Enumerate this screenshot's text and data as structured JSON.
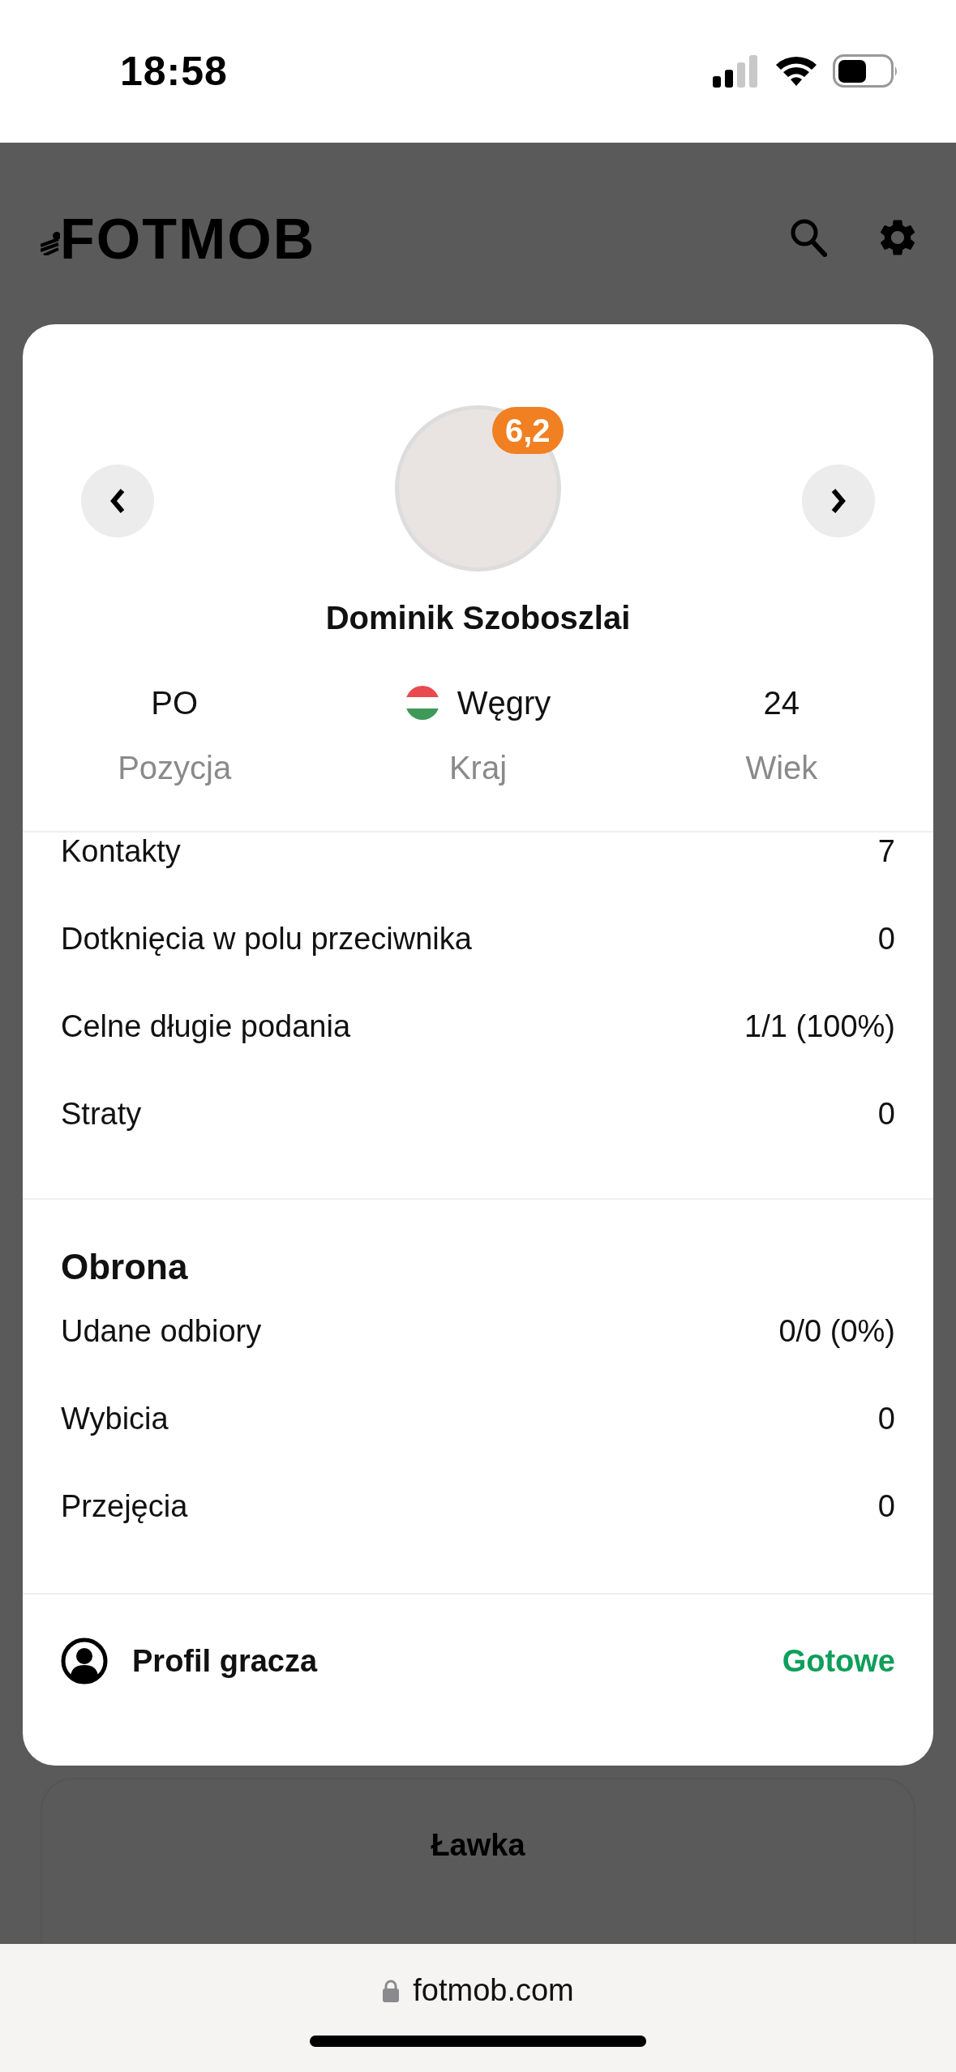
{
  "status_bar": {
    "time": "18:58"
  },
  "header": {
    "logo": "FOTMOB"
  },
  "player_card": {
    "rating": "6,2",
    "name": "Dominik Szoboszlai",
    "info": [
      {
        "kind": "text",
        "value": "PO",
        "label": "Pozycja"
      },
      {
        "kind": "country",
        "value": "Węgry",
        "label": "Kraj"
      },
      {
        "kind": "text",
        "value": "24",
        "label": "Wiek"
      }
    ],
    "stat_groups": [
      {
        "rows": [
          {
            "label": "Kontakty",
            "value": "7"
          },
          {
            "label": "Dotknięcia w polu przeciwnika",
            "value": "0"
          },
          {
            "label": "Celne długie podania",
            "value": "1/1 (100%)"
          },
          {
            "label": "Straty",
            "value": "0"
          }
        ]
      },
      {
        "title": "Obrona",
        "rows": [
          {
            "label": "Udane odbiory",
            "value": "0/0 (0%)"
          },
          {
            "label": "Wybicia",
            "value": "0"
          },
          {
            "label": "Przejęcia",
            "value": "0"
          }
        ]
      }
    ],
    "footer": {
      "profile_link": "Profil gracza",
      "done_button": "Gotowe"
    }
  },
  "bench": {
    "title": "Ławka"
  },
  "browser_bar": {
    "url": "fotmob.com"
  }
}
